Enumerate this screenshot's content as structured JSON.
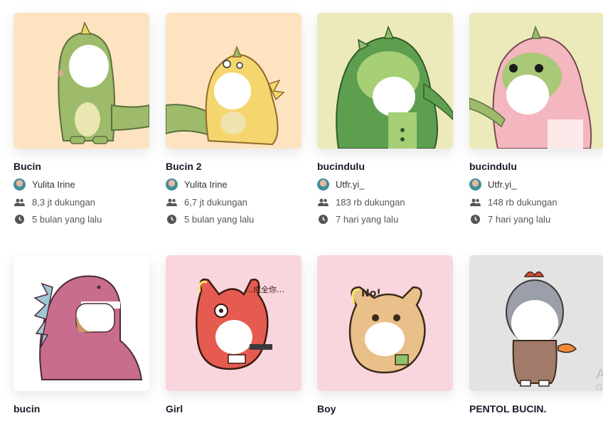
{
  "stories": [
    {
      "title": "Bucin",
      "author": "Yulita Irine",
      "supports": "8,3 jt dukungan",
      "time": "5 bulan yang lalu",
      "bg": "#fde3bf"
    },
    {
      "title": "Bucin 2",
      "author": "Yulita Irine",
      "supports": "6,7 jt dukungan",
      "time": "5 bulan yang lalu",
      "bg": "#fde3bf"
    },
    {
      "title": "bucindulu",
      "author": "Utfr.yi_",
      "supports": "183 rb dukungan",
      "time": "7 hari yang lalu",
      "bg": "#ece9bb"
    },
    {
      "title": "bucindulu",
      "author": "Utfr.yi_",
      "supports": "148 rb dukungan",
      "time": "7 hari yang lalu",
      "bg": "#ece9bb"
    },
    {
      "title": "bucin",
      "bg": "#ffffff"
    },
    {
      "title": "Girl",
      "bg": "#f9d6de"
    },
    {
      "title": "Boy",
      "bg": "#f9d6de"
    },
    {
      "title": "PENTOL BUCIN.",
      "bg": "#e3e3e3"
    }
  ],
  "sticker_texts": {
    "girl": "…成全你…",
    "boy": "No!"
  },
  "watermark": {
    "line1": "A",
    "line2": "Go"
  },
  "icons": {
    "supports": "people-icon",
    "time": "clock-icon"
  }
}
